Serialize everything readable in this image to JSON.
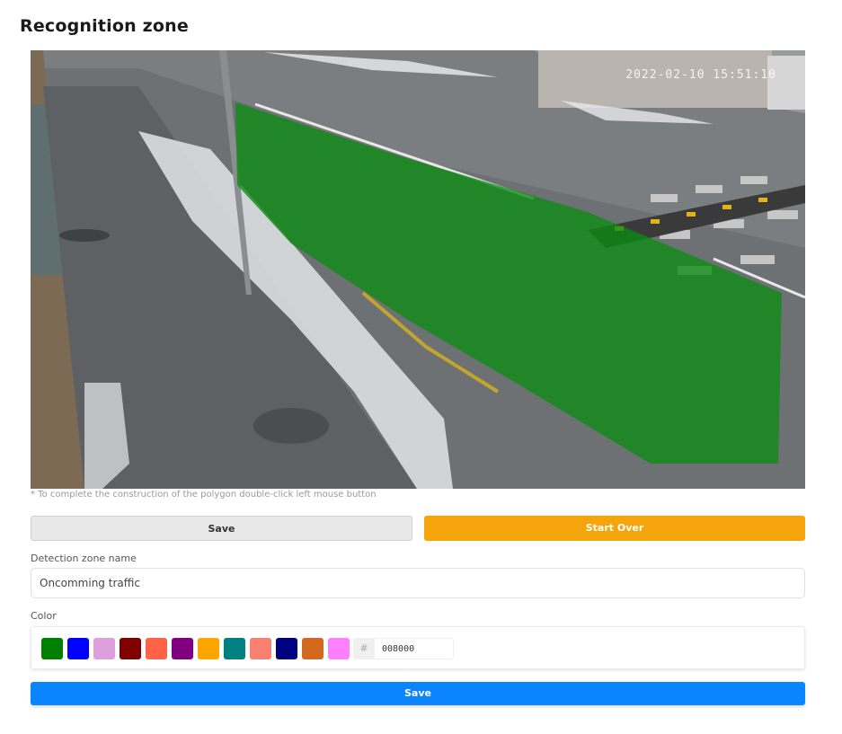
{
  "page": {
    "title": "Recognition zone"
  },
  "camera": {
    "timestamp": "2022-02-10 15:51:10",
    "zone_color": "#008000"
  },
  "hint": "* To complete the construction of the polygon double-click left mouse button",
  "actions": {
    "save_label": "Save",
    "start_over_label": "Start Over"
  },
  "form": {
    "name_label": "Detection zone name",
    "name_value": "Oncomming traffic",
    "color_label": "Color",
    "hex_prefix": "#",
    "hex_value": "008000",
    "swatches": [
      "#008000",
      "#0000ff",
      "#dda0dd",
      "#800000",
      "#ff6347",
      "#800080",
      "#ffa500",
      "#008080",
      "#fa8072",
      "#000080",
      "#d2691e",
      "#ff80ff"
    ]
  },
  "footer": {
    "save_label": "Save"
  }
}
